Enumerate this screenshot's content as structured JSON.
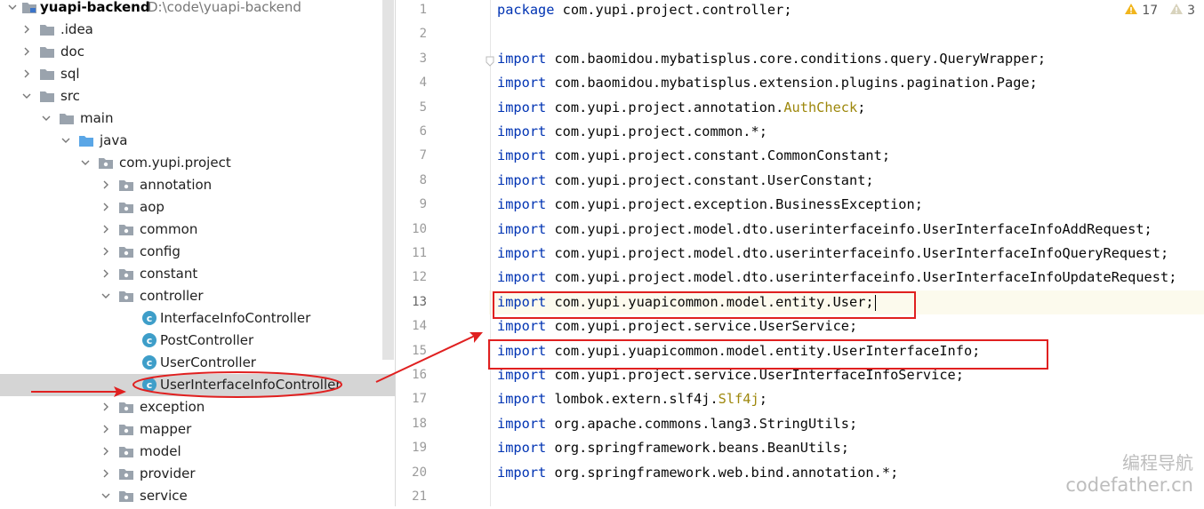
{
  "project_tree": {
    "root": {
      "label": "yuapi-backend",
      "path": "D:\\code\\yuapi-backend"
    },
    "items": [
      {
        "label": ".idea",
        "kind": "folder",
        "level": 1,
        "expanded": false
      },
      {
        "label": "doc",
        "kind": "folder",
        "level": 1,
        "expanded": false
      },
      {
        "label": "sql",
        "kind": "folder",
        "level": 1,
        "expanded": false
      },
      {
        "label": "src",
        "kind": "folder",
        "level": 1,
        "expanded": true
      },
      {
        "label": "main",
        "kind": "folder",
        "level": 2,
        "expanded": true
      },
      {
        "label": "java",
        "kind": "source-folder",
        "level": 3,
        "expanded": true
      },
      {
        "label": "com.yupi.project",
        "kind": "package",
        "level": 4,
        "expanded": true
      },
      {
        "label": "annotation",
        "kind": "package",
        "level": 5,
        "expanded": false
      },
      {
        "label": "aop",
        "kind": "package",
        "level": 5,
        "expanded": false
      },
      {
        "label": "common",
        "kind": "package",
        "level": 5,
        "expanded": false
      },
      {
        "label": "config",
        "kind": "package",
        "level": 5,
        "expanded": false
      },
      {
        "label": "constant",
        "kind": "package",
        "level": 5,
        "expanded": false
      },
      {
        "label": "controller",
        "kind": "package",
        "level": 5,
        "expanded": true
      },
      {
        "label": "InterfaceInfoController",
        "kind": "class",
        "level": 6
      },
      {
        "label": "PostController",
        "kind": "class",
        "level": 6
      },
      {
        "label": "UserController",
        "kind": "class",
        "level": 6
      },
      {
        "label": "UserInterfaceInfoController",
        "kind": "class",
        "level": 6,
        "selected": true
      },
      {
        "label": "exception",
        "kind": "package",
        "level": 5,
        "expanded": false
      },
      {
        "label": "mapper",
        "kind": "package",
        "level": 5,
        "expanded": false
      },
      {
        "label": "model",
        "kind": "package",
        "level": 5,
        "expanded": false
      },
      {
        "label": "provider",
        "kind": "package",
        "level": 5,
        "expanded": false
      },
      {
        "label": "service",
        "kind": "package",
        "level": 5,
        "expanded": true
      }
    ]
  },
  "inspections": {
    "warnings": "17",
    "weak_warnings": "3"
  },
  "editor": {
    "current_line": 13,
    "lines": [
      {
        "n": "1",
        "kw": "package",
        "text": " com.yupi.project.controller;"
      },
      {
        "n": "2",
        "kw": "",
        "text": ""
      },
      {
        "n": "3",
        "kw": "import",
        "text": " com.baomidou.mybatisplus.core.conditions.query.QueryWrapper;"
      },
      {
        "n": "4",
        "kw": "import",
        "text": " com.baomidou.mybatisplus.extension.plugins.pagination.Page;"
      },
      {
        "n": "5",
        "kw": "import",
        "text": " com.yupi.project.annotation.",
        "ann": "AuthCheck",
        "tail": ";"
      },
      {
        "n": "6",
        "kw": "import",
        "text": " com.yupi.project.common.*;"
      },
      {
        "n": "7",
        "kw": "import",
        "text": " com.yupi.project.constant.CommonConstant;"
      },
      {
        "n": "8",
        "kw": "import",
        "text": " com.yupi.project.constant.UserConstant;"
      },
      {
        "n": "9",
        "kw": "import",
        "text": " com.yupi.project.exception.BusinessException;"
      },
      {
        "n": "10",
        "kw": "import",
        "text": " com.yupi.project.model.dto.userinterfaceinfo.UserInterfaceInfoAddRequest;"
      },
      {
        "n": "11",
        "kw": "import",
        "text": " com.yupi.project.model.dto.userinterfaceinfo.UserInterfaceInfoQueryRequest;"
      },
      {
        "n": "12",
        "kw": "import",
        "text": " com.yupi.project.model.dto.userinterfaceinfo.UserInterfaceInfoUpdateRequest;"
      },
      {
        "n": "13",
        "kw": "import",
        "text": " com.yupi.yuapicommon.model.entity.User;"
      },
      {
        "n": "14",
        "kw": "import",
        "text": " com.yupi.project.service.UserService;"
      },
      {
        "n": "15",
        "kw": "import",
        "text": " com.yupi.yuapicommon.model.entity.UserInterfaceInfo;"
      },
      {
        "n": "16",
        "kw": "import",
        "text": " com.yupi.project.service.UserInterfaceInfoService;"
      },
      {
        "n": "17",
        "kw": "import",
        "text": " lombok.extern.slf4j.",
        "ann": "Slf4j",
        "tail": ";"
      },
      {
        "n": "18",
        "kw": "import",
        "text": " org.apache.commons.lang3.StringUtils;"
      },
      {
        "n": "19",
        "kw": "import",
        "text": " org.springframework.beans.BeanUtils;"
      },
      {
        "n": "20",
        "kw": "import",
        "text": " org.springframework.web.bind.annotation.*;"
      },
      {
        "n": "21",
        "kw": "",
        "text": ""
      }
    ]
  },
  "watermark": {
    "line1": "编程导航",
    "line2": "codefather.cn"
  },
  "colors": {
    "annotation_red": "#e02020",
    "keyword": "#0033b3",
    "annotation_yellow": "#9e880d",
    "selection": "#d5d5d5"
  }
}
